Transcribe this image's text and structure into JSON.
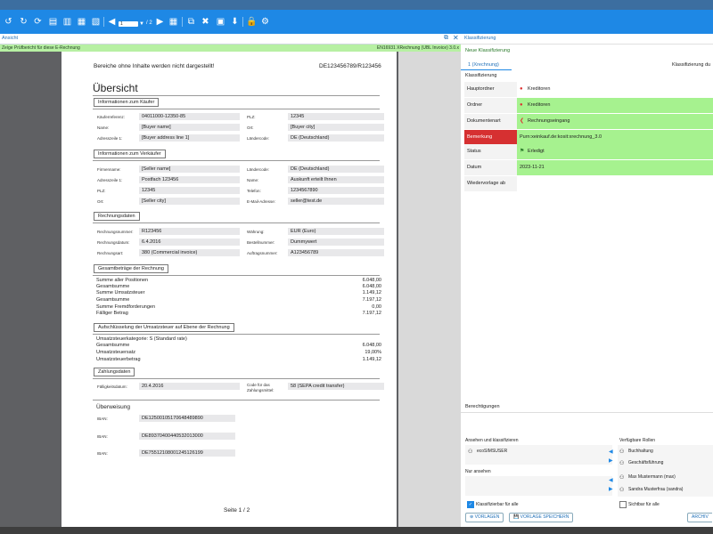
{
  "toolbar": {
    "page_current": "1",
    "page_total": "/ 2"
  },
  "viewer": {
    "title": "Ansicht",
    "report_link": "Zeige Prüfbericht für diese E-Rechnung",
    "format_label": "EN16931 XRechnung (UBL Invoice) 3.0.x"
  },
  "doc": {
    "note": "Bereiche ohne Inhalte werden nicht dargestellt!",
    "ref": "DE123456789/R123456",
    "heading": "Übersicht",
    "s_buyer": "Informationen zum Käufer",
    "buyer": {
      "l1": "Käuferreferenz:",
      "v1": "04011000-12350-85",
      "l2": "Name:",
      "v2": "[Buyer name]",
      "l3": "Adresszeile 1:",
      "v3": "[Buyer address line 1]",
      "r1": "PLZ:",
      "rv1": "12345",
      "r2": "Ort:",
      "rv2": "[Buyer city]",
      "r3": "Ländercode:",
      "rv3": "DE (Deutschland)"
    },
    "s_seller": "Informationen zum Verkäufer",
    "seller": {
      "l1": "Firmenname:",
      "v1": "[Seller name]",
      "l2": "Adresszeile 1:",
      "v2": "Postfach 123456",
      "l3": "PLZ:",
      "v3": "12345",
      "l4": "Ort:",
      "v4": "[Seller city]",
      "r1": "Ländercode:",
      "rv1": "DE (Deutschland)",
      "r2": "Name:",
      "rv2": "Auskunft erteilt Ihnen",
      "r3": "Telefon:",
      "rv3": "1234567890",
      "r4": "E-Mail-Adresse:",
      "rv4": "seller@test.de"
    },
    "s_invoice": "Rechnungsdaten",
    "invoice": {
      "l1": "Rechnungsnummer:",
      "v1": "R123456",
      "l2": "Rechnungsdatum:",
      "v2": "6.4.2016",
      "l3": "Rechnungsart:",
      "v3": "380 (Commercial invoice)",
      "r1": "Währung:",
      "rv1": "EUR (Euro)",
      "r2": "Bestellnummer:",
      "rv2": "Dummywert",
      "r3": "Auftragsnummer:",
      "rv3": "A123456789"
    },
    "s_totals": "Gesamtbeträge der Rechnung",
    "totals": [
      {
        "label": "Summe aller Positionen",
        "value": "6.048,00"
      },
      {
        "label": "Gesamtsumme",
        "value": "6.048,00"
      },
      {
        "label": "Summe Umsatzsteuer",
        "value": "1.149,12"
      },
      {
        "label": "Gesamtsumme",
        "value": "7.197,12"
      },
      {
        "label": "Summe Fremdforderungen",
        "value": "0,00"
      },
      {
        "label": "Fälliger Betrag",
        "value": "7.197,12"
      }
    ],
    "s_vat": "Aufschlüsselung der Umsatzsteuer auf Ebene der Rechnung",
    "vat_category": "Umsatzsteuerkategorie: S (Standard rate)",
    "vat": [
      {
        "label": "Gesamtsumme",
        "value": "6.048,00"
      },
      {
        "label": "Umsatzsteuersatz",
        "value": "19,00%"
      },
      {
        "label": "Umsatzsteuerbetrag",
        "value": "1.149,12"
      }
    ],
    "s_payment": "Zahlungsdaten",
    "payment": {
      "l1": "Fälligkeitsdatum:",
      "v1": "20.4.2016",
      "r1a": "Code für das",
      "r1b": "Zahlungsmittel:",
      "rv1": "58 (SEPA credit transfer)"
    },
    "transfer_title": "Überweisung",
    "iban_label": "IBAN:",
    "ibans": [
      "DE12500105170648489890",
      "DE89370400440532013000",
      "DE75512108001245126199"
    ],
    "page_footer": "Seite 1 / 2"
  },
  "panel": {
    "title": "Klassifizierung",
    "new": "Neue Klassifizierung",
    "tab": "1 (Xrechnung)",
    "section": "Klassifizierung",
    "cut_label": "Klassifizierung du",
    "rows": [
      {
        "label": "Hauptordner",
        "value": "Kreditoren"
      },
      {
        "label": "Ordner",
        "value": "Kreditoren"
      },
      {
        "label": "Dokumentenart",
        "value": "Rechnungseingang"
      },
      {
        "label": "Bemerkung",
        "value": "Purn:xeinkauf.de:kosit:xrechnung_3.0"
      },
      {
        "label": "Status",
        "value": "Erledigt"
      },
      {
        "label": "Datum",
        "value": "2023-11-21"
      },
      {
        "label": "Wiedervorlage ab",
        "value": ""
      }
    ],
    "perm_title": "Berechtigungen",
    "view_classify": "Ansehen und klassifizieren",
    "view_only": "Nur ansehen",
    "available_roles": "Verfügbare Rollen",
    "users": [
      "ecoSIMSUSER"
    ],
    "roles": [
      "Buchhaltung",
      "Geschäftsführung",
      "Max Mustermann (max)",
      "Sandra Musterfrau (sandra)"
    ],
    "classifiable_all": "Klassifizierbar für alle",
    "visible_all": "Sichtbar für alle",
    "btn_templates": "VORLAGEN",
    "btn_save_template": "VORLAGE SPEICHERN",
    "btn_archive": "ARCHIV"
  }
}
